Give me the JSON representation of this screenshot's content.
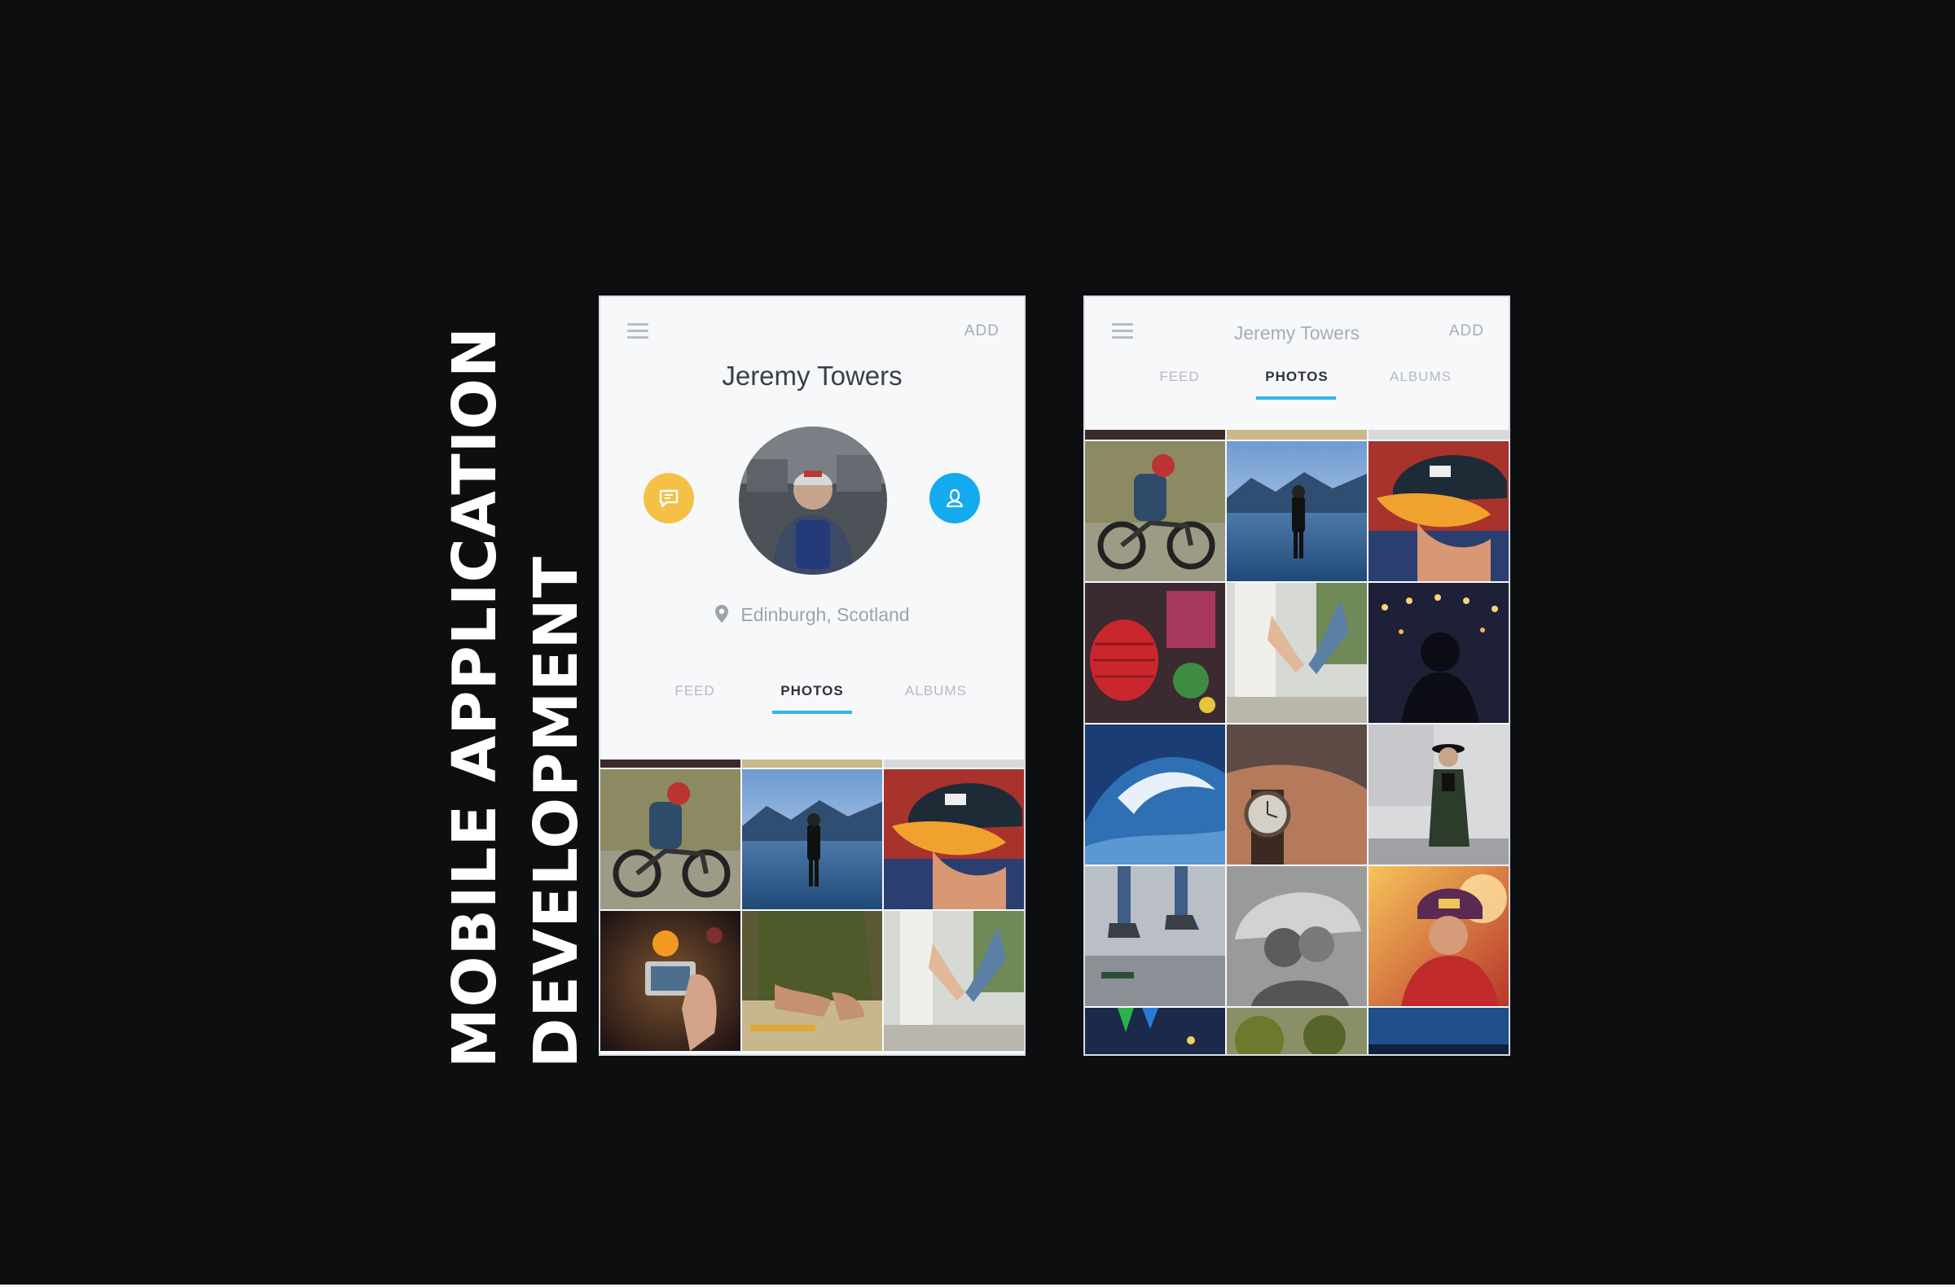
{
  "page": {
    "heading_line1": "MOBILE APPLICATION",
    "heading_line2": "DEVELOPMENT"
  },
  "phone1": {
    "menu_icon": "hamburger-menu-icon",
    "add_label": "ADD",
    "profile_name": "Jeremy Towers",
    "chat_icon": "chat-bubble-icon",
    "profile_icon": "user-icon",
    "location_icon": "map-pin-icon",
    "location": "Edinburgh, Scotland",
    "tabs": [
      {
        "label": "FEED",
        "active": false
      },
      {
        "label": "PHOTOS",
        "active": true
      },
      {
        "label": "ALBUMS",
        "active": false
      }
    ],
    "photos": [
      "motorcycle-rider",
      "man-by-lake-mountains",
      "man-orange-cap",
      "hand-holding-camera",
      "hands-crafting",
      "couple-holding-hands"
    ]
  },
  "phone2": {
    "menu_icon": "hamburger-menu-icon",
    "title": "Jeremy Towers",
    "add_label": "ADD",
    "tabs": [
      {
        "label": "FEED",
        "active": false
      },
      {
        "label": "PHOTOS",
        "active": true
      },
      {
        "label": "ALBUMS",
        "active": false
      }
    ],
    "photos": [
      "motorcycle-rider",
      "man-by-lake-mountains",
      "man-orange-cap",
      "red-lanterns",
      "couple-holding-hands",
      "woman-string-lights",
      "ocean-wave-surfer",
      "wrist-watch",
      "woman-hat-street",
      "legs-sneakers",
      "couple-umbrella-kiss",
      "boy-cap-sunset",
      "festival-flags",
      "trees",
      "blue-sky"
    ]
  },
  "colors": {
    "background": "#0d0e10",
    "accent_blue": "#31b5ee",
    "chat_yellow": "#f5c046",
    "profile_blue": "#14aaf0"
  }
}
